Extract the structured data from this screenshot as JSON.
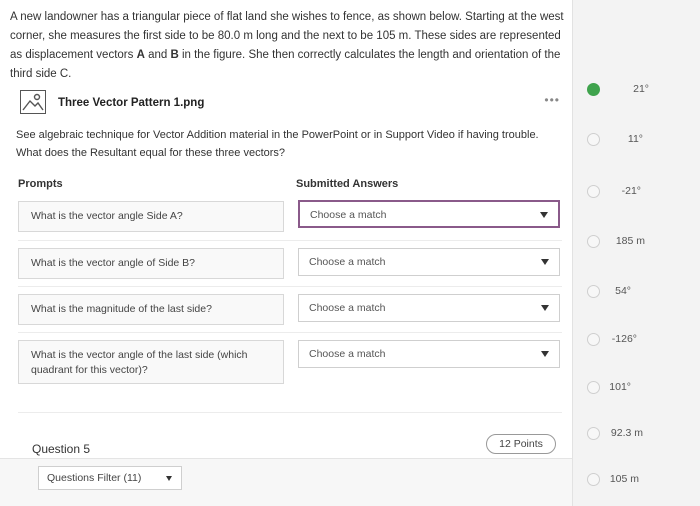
{
  "intro": {
    "part1": "A new landowner has a triangular piece of flat land she wishes to fence, as shown below. Starting at the west corner, she measures the first side to be 80.0 m long and the next to be 105 m. These sides are represented as displacement vectors ",
    "bold_a": "A",
    "part2": " and ",
    "bold_b": "B",
    "part3": " in the figure. She then correctly calculates the length and orientation of the third side C."
  },
  "attachment": {
    "icon": "image-file-icon",
    "name": "Three Vector Pattern 1.png",
    "more": "•••"
  },
  "instructions": {
    "line1": "See algebraic technique for Vector Addition material in the PowerPoint or in Support Video if having trouble.",
    "line2": "What does the Resultant equal for these three vectors?"
  },
  "headers": {
    "prompts": "Prompts",
    "answers": "Submitted Answers"
  },
  "rows": [
    {
      "prompt": "What is the vector angle Side A?",
      "answer": "Choose a match"
    },
    {
      "prompt": "What is the vector angle of Side B?",
      "answer": "Choose a match"
    },
    {
      "prompt": "What is the magnitude of the last side?",
      "answer": "Choose a match"
    },
    {
      "prompt": "What is the vector angle of the last side (which quadrant for this vector)?",
      "answer": "Choose a match"
    }
  ],
  "footer": {
    "question": "Question 5",
    "points": "12 Points",
    "filter": "Questions Filter (11)"
  },
  "choices": [
    {
      "label": "21°",
      "selected": true
    },
    {
      "label": "11°",
      "selected": false
    },
    {
      "label": "-21°",
      "selected": false
    },
    {
      "label": "185 m",
      "selected": false
    },
    {
      "label": "54°",
      "selected": false
    },
    {
      "label": "-126°",
      "selected": false
    },
    {
      "label": "101°",
      "selected": false
    },
    {
      "label": "92.3 m",
      "selected": false
    },
    {
      "label": "105 m",
      "selected": false
    }
  ],
  "colors": {
    "selected_radio": "#3fa34d",
    "active_border": "#8a5a8a"
  }
}
